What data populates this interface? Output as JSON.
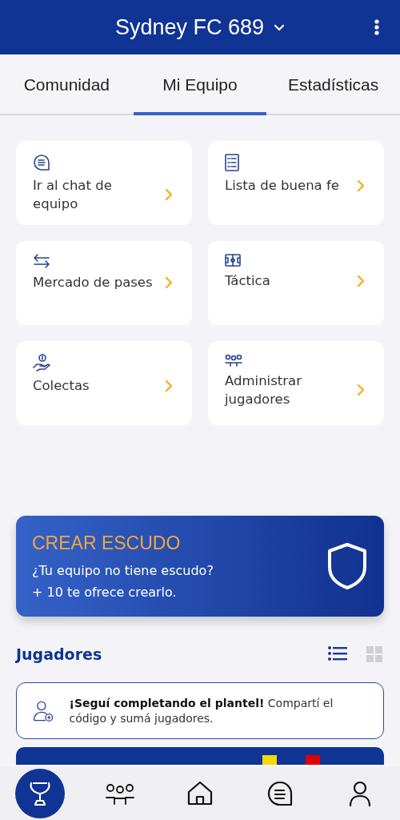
{
  "header": {
    "title": "Sydney FC 689"
  },
  "tabs": [
    {
      "label": "Comunidad",
      "selected": false
    },
    {
      "label": "Mi Equipo",
      "selected": true
    },
    {
      "label": "Estadísticas",
      "selected": false
    }
  ],
  "shortcuts": [
    {
      "kind": "chat",
      "label": "Ir al chat de equipo"
    },
    {
      "kind": "list",
      "label": "Lista de buena fe"
    },
    {
      "kind": "transfer",
      "label": "Mercado de pases"
    },
    {
      "kind": "field",
      "label": "Táctica"
    },
    {
      "kind": "donation",
      "label": "Colectas"
    },
    {
      "kind": "players",
      "label": "Administrar jugadores"
    }
  ],
  "banner": {
    "title": "CREAR ESCUDO",
    "lines": [
      "¿Tu equipo no tiene escudo?",
      "+ 10 te ofrece crearlo."
    ]
  },
  "players": {
    "title": "Jugadores",
    "views": [
      {
        "kind": "list",
        "selected": true
      },
      {
        "kind": "grid",
        "selected": false
      }
    ],
    "invite": "**¡Seguí completando el plantel!** Compartí el código y sumá jugadores.",
    "card_columns": [
      {
        "color": "#f5d800"
      },
      {
        "color": "#e00000"
      }
    ]
  },
  "nav": [
    {
      "kind": "trophy",
      "selected": true
    },
    {
      "kind": "players",
      "selected": false
    },
    {
      "kind": "home",
      "selected": false
    },
    {
      "kind": "chat",
      "selected": false
    },
    {
      "kind": "profile",
      "selected": false
    }
  ]
}
